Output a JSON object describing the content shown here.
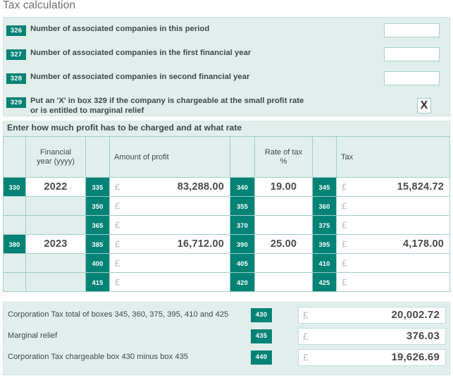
{
  "page": {
    "title": "Tax calculation"
  },
  "associated_companies": {
    "rows": [
      {
        "box": "326",
        "label": "Number of associated companies in this period",
        "value": "",
        "type": "input"
      },
      {
        "box": "327",
        "label": "Number of associated companies in the first financial year",
        "value": "",
        "type": "input"
      },
      {
        "box": "328",
        "label": "Number of associated companies in second financial year",
        "value": "",
        "type": "input"
      },
      {
        "box": "329",
        "label": "Put an 'X' in box 329 if the company is chargeable at the small profit rate\nor is entitled to marginal relief",
        "value": "X",
        "type": "checkbox"
      }
    ]
  },
  "instruction": "Enter how much profit has to be charged and at what rate",
  "profit_table": {
    "headers": {
      "financial_year": "Financial\nyear (yyyy)",
      "amount_of_profit": "Amount of profit",
      "rate_of_tax": "Rate of tax\n%",
      "tax": "Tax"
    },
    "currency_symbol": "£",
    "rows": [
      {
        "year_box": "330",
        "year": "2022",
        "profit_box": "335",
        "profit": "83,288.00",
        "rate_box": "340",
        "rate": "19.00",
        "tax_box": "345",
        "tax": "15,824.72"
      },
      {
        "year_box": "",
        "year": "",
        "profit_box": "350",
        "profit": "",
        "rate_box": "355",
        "rate": "",
        "tax_box": "360",
        "tax": ""
      },
      {
        "year_box": "",
        "year": "",
        "profit_box": "365",
        "profit": "",
        "rate_box": "370",
        "rate": "",
        "tax_box": "375",
        "tax": ""
      },
      {
        "year_box": "380",
        "year": "2023",
        "profit_box": "385",
        "profit": "16,712.00",
        "rate_box": "390",
        "rate": "25.00",
        "tax_box": "395",
        "tax": "4,178.00"
      },
      {
        "year_box": "",
        "year": "",
        "profit_box": "400",
        "profit": "",
        "rate_box": "405",
        "rate": "",
        "tax_box": "410",
        "tax": ""
      },
      {
        "year_box": "",
        "year": "",
        "profit_box": "415",
        "profit": "",
        "rate_box": "420",
        "rate": "",
        "tax_box": "425",
        "tax": ""
      }
    ]
  },
  "summary": {
    "currency_symbol": "£",
    "rows": [
      {
        "label": "Corporation Tax total of boxes 345, 360, 375, 395, 410 and 425",
        "box": "430",
        "value": "20,002.72"
      },
      {
        "label": "Marginal relief",
        "box": "435",
        "value": "376.03"
      },
      {
        "label": "Corporation Tax chargeable box 430 minus box 435",
        "box": "440",
        "value": "19,626.69"
      }
    ]
  },
  "colors": {
    "box_teal": "#008275",
    "panel_bg": "#e1eeec",
    "table_border": "#9ccfcb",
    "text": "#3d4a4f",
    "title_gray": "#6e6e6e",
    "currency_gray": "#b4b9ba"
  }
}
